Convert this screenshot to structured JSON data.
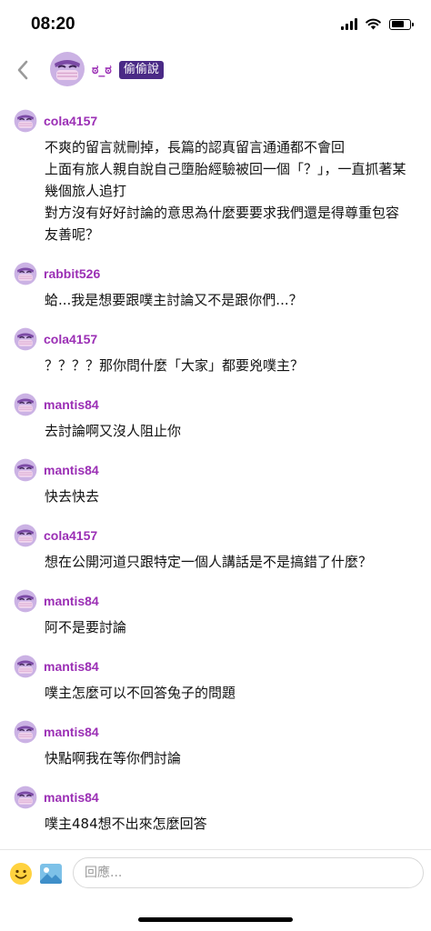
{
  "status_bar": {
    "time": "08:20",
    "battery_level": 0.7
  },
  "header": {
    "back_icon": "chevron-left-icon",
    "avatar_icon": "masked-face-avatar-icon",
    "name": "ಠ_ಠ",
    "badge": "偷偷說"
  },
  "messages": [
    {
      "user": "cola4157",
      "text": "不爽的留言就刪掉，長篇的認真留言通通都不會回\n上面有旅人親自說自己墮胎經驗被回一個「？」，一直抓著某幾個旅人追打\n對方沒有好好討論的意思為什麼要要求我們還是得尊重包容友善呢？"
    },
    {
      "user": "rabbit526",
      "text": "蛤...我是想要跟噗主討論又不是跟你們...？"
    },
    {
      "user": "cola4157",
      "text": "？？？？那你問什麼「大家」都要兇噗主？"
    },
    {
      "user": "mantis84",
      "text": "去討論啊又沒人阻止你"
    },
    {
      "user": "mantis84",
      "text": "快去快去"
    },
    {
      "user": "cola4157",
      "text": "想在公開河道只跟特定一個人講話是不是搞錯了什麼？"
    },
    {
      "user": "mantis84",
      "text": "阿不是要討論"
    },
    {
      "user": "mantis84",
      "text": "噗主怎麼可以不回答兔子的問題"
    },
    {
      "user": "mantis84",
      "text": "快點啊我在等你們討論"
    },
    {
      "user": "mantis84",
      "text": "噗主484想不出來怎麼回答"
    }
  ],
  "composer": {
    "emoji_icon": "smiley-face-icon",
    "image_icon": "image-picture-icon",
    "placeholder": "回應..."
  },
  "colors": {
    "username": "#9b2fb5",
    "badge_bg": "#4a2a86",
    "avatar": "#b58ad0"
  }
}
